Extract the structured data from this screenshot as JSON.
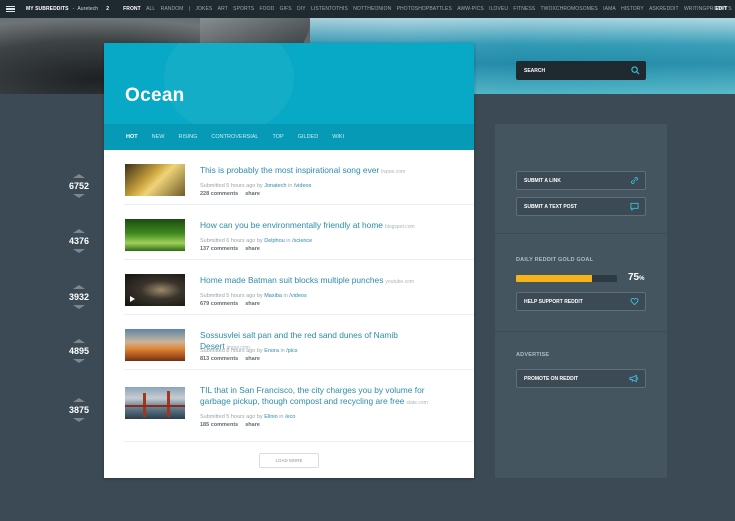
{
  "topbar": {
    "my_subreddits": "MY SUBREDDITS",
    "separator": "-",
    "username": "Auretech",
    "badge": "2",
    "links": [
      "FRONT",
      "ALL",
      "RANDOM",
      "|",
      "JOKES",
      "ART",
      "SPORTS",
      "FOOD",
      "GIFS",
      "DIY",
      "LISTENTOTHIS",
      "NOTTHEONION",
      "PHOTOSHOPBATTLES",
      "AWW-PICS",
      "ILOVEU",
      "FITNESS",
      "TWOXCHROMOSOMES",
      "IAMA",
      "HISTORY",
      "ASKREDDIT",
      "WRITINGPROMPTS"
    ],
    "active_link": "FRONT",
    "edit": "EDIT"
  },
  "search": {
    "label": "SEARCH"
  },
  "subreddit": {
    "title": "Ocean",
    "tabs": [
      "HOT",
      "NEW",
      "RISING",
      "CONTROVERSIAL",
      "TOP",
      "GILDED",
      "WIKI"
    ],
    "active_tab": "HOT"
  },
  "posts": [
    {
      "score": "6752",
      "title": "This is probably the most inspirational song ever",
      "domain": "livpoe.com",
      "submitted": "Submitted 5 hours ago by",
      "author": "Jonatech",
      "in": "in",
      "sub": "/videos",
      "comments": "228 comments",
      "share": "share",
      "thumb": "music"
    },
    {
      "score": "4376",
      "title": "How can you be environmentally friendly at home",
      "domain": "blogspot.com",
      "submitted": "Submitted 6 hours ago by",
      "author": "Delphou",
      "in": "in",
      "sub": "/science",
      "comments": "137 comments",
      "share": "share",
      "thumb": "forest"
    },
    {
      "score": "3932",
      "title": "Home made Batman suit blocks multiple punches",
      "domain": "youtube.com",
      "submitted": "Submitted 5 hours ago by",
      "author": "Maxiba",
      "in": "in",
      "sub": "/videos",
      "comments": "679 comments",
      "share": "share",
      "thumb": "video"
    },
    {
      "score": "4895",
      "title": "Sossusvlei salt pan and the red sand dunes of Namib Desert",
      "domain": "imgur.com",
      "submitted": "Submitted 8 hours ago by",
      "author": "Enora",
      "in": "in",
      "sub": "/pics",
      "comments": "813 comments",
      "share": "share",
      "thumb": "desert"
    },
    {
      "score": "3875",
      "title": "TIL that in San Francisco, the city charges you by volume for garbage pickup, though compost and recycling are free",
      "domain": "slate.com",
      "submitted": "Submitted 5 hours ago by",
      "author": "Elinio",
      "in": "in",
      "sub": "/eco",
      "comments": "185 comments",
      "share": "share",
      "thumb": "bridge"
    }
  ],
  "load_more": "LOAD MORE",
  "sidebar": {
    "submit_link": "SUBMIT A LINK",
    "submit_text": "SUBMIT A TEXT POST",
    "goal_heading": "DAILY REDDIT GOLD GOAL",
    "goal_value": "75",
    "goal_unit": "%",
    "goal_fraction": 0.75,
    "help_support": "HELP SUPPORT REDDIT",
    "advertise_heading": "ADVERTISE",
    "promote": "PROMOTE ON REDDIT"
  },
  "colors": {
    "accent": "#08a9c6",
    "link": "#2b8ca9",
    "gold": "#f6b31b",
    "background": "#3b4a54",
    "sidebar": "#455560"
  }
}
